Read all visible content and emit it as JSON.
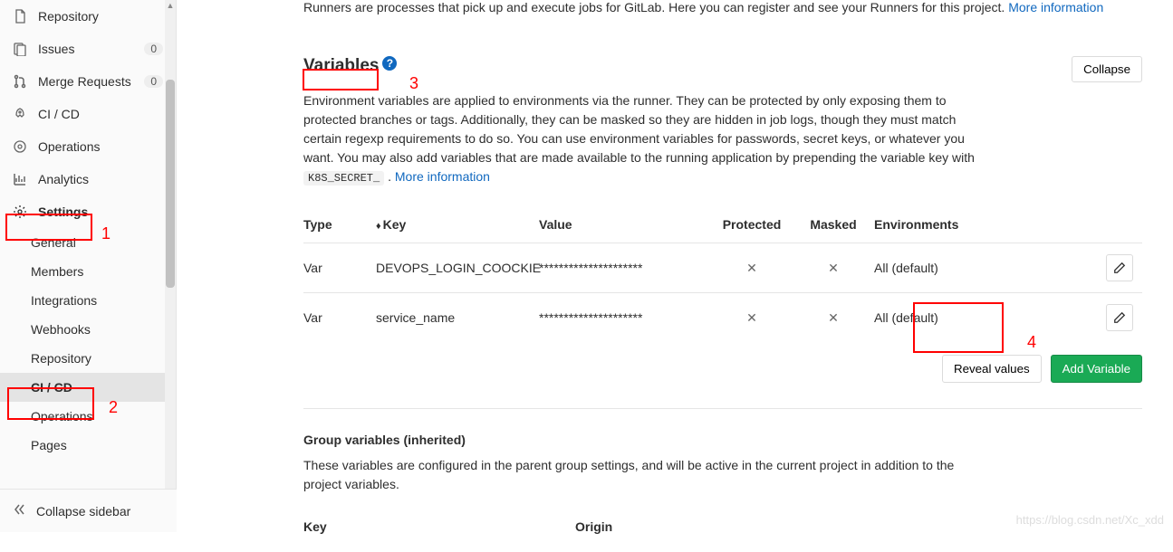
{
  "sidebar": {
    "items": [
      {
        "label": "Repository"
      },
      {
        "label": "Issues",
        "badge": "0"
      },
      {
        "label": "Merge Requests",
        "badge": "0"
      },
      {
        "label": "CI / CD"
      },
      {
        "label": "Operations"
      },
      {
        "label": "Analytics"
      },
      {
        "label": "Settings"
      }
    ],
    "subitems": [
      {
        "label": "General"
      },
      {
        "label": "Members"
      },
      {
        "label": "Integrations"
      },
      {
        "label": "Webhooks"
      },
      {
        "label": "Repository"
      },
      {
        "label": "CI / CD"
      },
      {
        "label": "Operations"
      },
      {
        "label": "Pages"
      }
    ],
    "collapse_label": "Collapse sidebar"
  },
  "runners": {
    "text": "Runners are processes that pick up and execute jobs for GitLab. Here you can register and see your Runners for this project. ",
    "more_link": "More information"
  },
  "variables": {
    "title": "Variables",
    "collapse_btn": "Collapse",
    "desc_1": "Environment variables are applied to environments via the runner. They can be protected by only exposing them to protected branches or tags. Additionally, they can be masked so they are hidden in job logs, though they must match certain regexp requirements to do so. You can use environment variables for passwords, secret keys, or whatever you want. You may also add variables that are made available to the running application by prepending the variable key with ",
    "code": "K8S_SECRET_",
    "desc_2": " . ",
    "more_link": "More information",
    "headers": {
      "type": "Type",
      "key": "Key",
      "value": "Value",
      "protected": "Protected",
      "masked": "Masked",
      "env": "Environments"
    },
    "rows": [
      {
        "type": "Var",
        "key": "DEVOPS_LOGIN_COOCKIE",
        "value": "*********************",
        "protected": "✕",
        "masked": "✕",
        "env": "All (default)"
      },
      {
        "type": "Var",
        "key": "service_name",
        "value": "*********************",
        "protected": "✕",
        "masked": "✕",
        "env": "All (default)"
      }
    ],
    "reveal_btn": "Reveal values",
    "add_btn": "Add Variable"
  },
  "group_vars": {
    "title": "Group variables (inherited)",
    "desc": "These variables are configured in the parent group settings, and will be active in the current project in addition to the project variables.",
    "key_header": "Key",
    "origin_header": "Origin"
  },
  "annotations": {
    "n1": "1",
    "n2": "2",
    "n3": "3",
    "n4": "4"
  },
  "watermark": "https://blog.csdn.net/Xc_xdd"
}
